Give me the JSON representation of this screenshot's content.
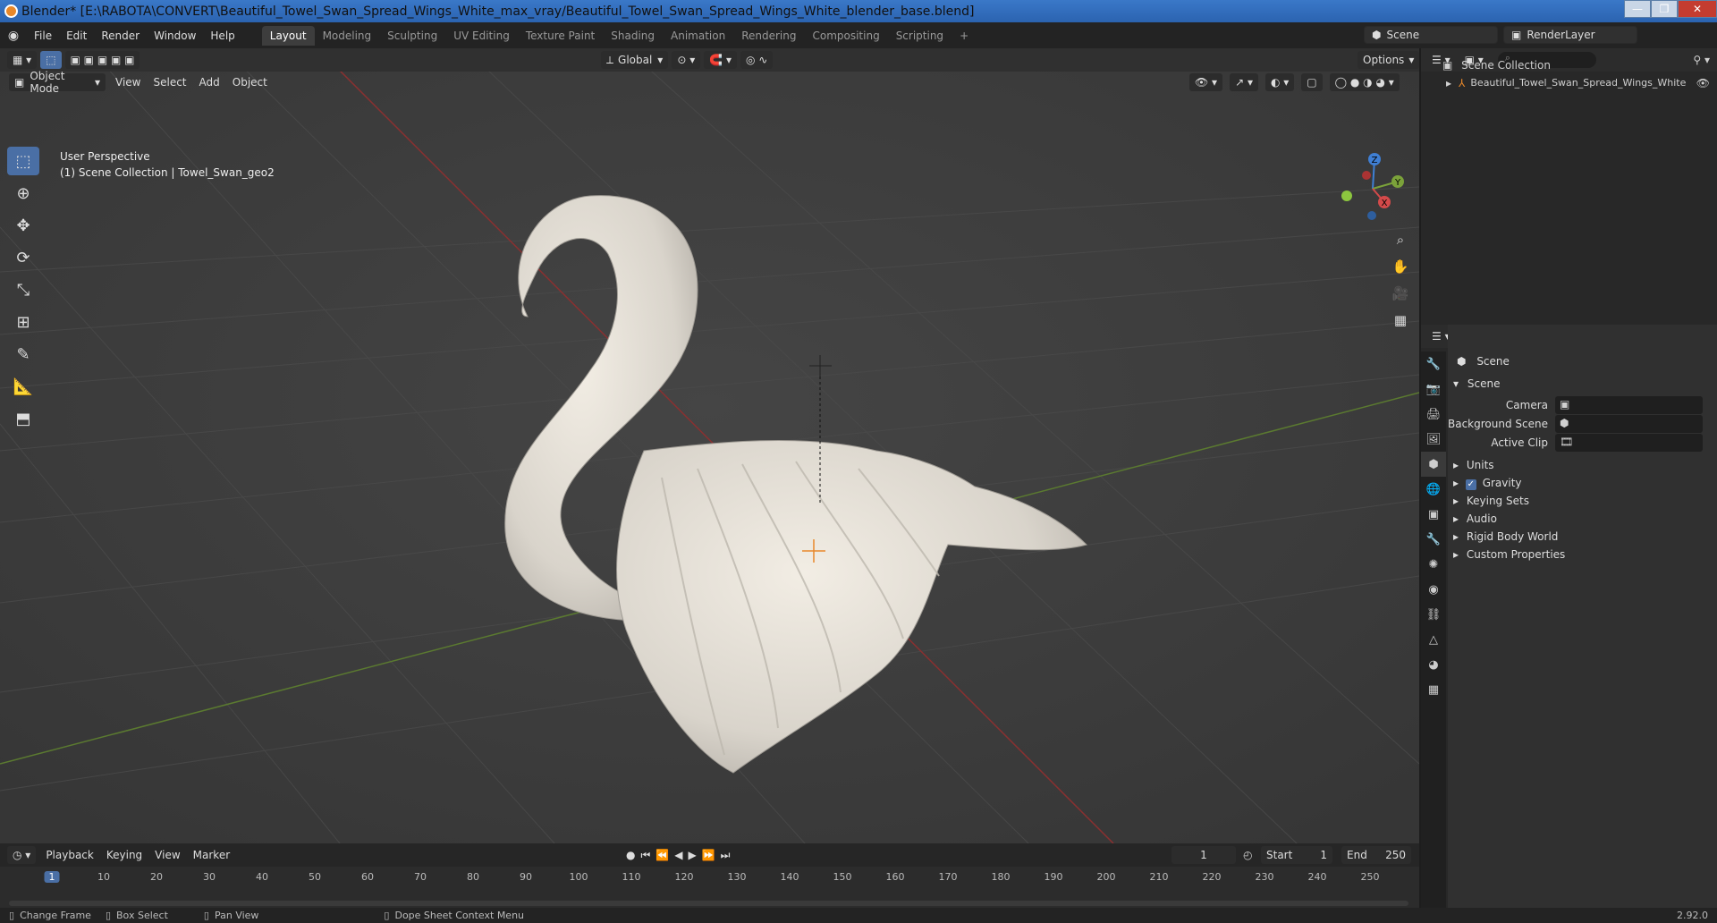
{
  "window": {
    "title": "Blender* [E:\\RABOTA\\CONVERT\\Beautiful_Towel_Swan_Spread_Wings_White_max_vray/Beautiful_Towel_Swan_Spread_Wings_White_blender_base.blend]"
  },
  "menu": [
    "File",
    "Edit",
    "Render",
    "Window",
    "Help"
  ],
  "workspaces": [
    "Layout",
    "Modeling",
    "Sculpting",
    "UV Editing",
    "Texture Paint",
    "Shading",
    "Animation",
    "Rendering",
    "Compositing",
    "Scripting"
  ],
  "workspace_add": "+",
  "scene_field": "Scene",
  "renderlayer_field": "RenderLayer",
  "viewport": {
    "transform_orientation": "Global",
    "options_label": "Options",
    "mode": "Object Mode",
    "header_menus": [
      "View",
      "Select",
      "Add",
      "Object"
    ],
    "perspective": "User Perspective",
    "collection_info": "(1) Scene Collection | Towel_Swan_geo2",
    "gizmo": {
      "x": "X",
      "y": "Y",
      "z": "Z"
    }
  },
  "outliner": {
    "root": "Scene Collection",
    "item": "Beautiful_Towel_Swan_Spread_Wings_White"
  },
  "properties": {
    "context": "Scene",
    "panel_title": "Scene",
    "camera_label": "Camera",
    "background_scene_label": "Background Scene",
    "active_clip_label": "Active Clip",
    "sections": [
      "Units",
      "Gravity",
      "Keying Sets",
      "Audio",
      "Rigid Body World",
      "Custom Properties"
    ]
  },
  "timeline": {
    "menus": [
      "Playback",
      "Keying",
      "View",
      "Marker"
    ],
    "current_frame": "1",
    "start_label": "Start",
    "start": "1",
    "end_label": "End",
    "end": "250",
    "ticks": [
      "1",
      "10",
      "20",
      "30",
      "40",
      "50",
      "60",
      "70",
      "80",
      "90",
      "100",
      "110",
      "120",
      "130",
      "140",
      "150",
      "160",
      "170",
      "180",
      "190",
      "200",
      "210",
      "220",
      "230",
      "240",
      "250"
    ]
  },
  "statusbar": {
    "items": [
      "Change Frame",
      "Box Select",
      "Pan View",
      "Dope Sheet Context Menu"
    ],
    "version": "2.92.0"
  },
  "colors": {
    "accent": "#4a6fa5",
    "x_axis": "#d44a4a",
    "y_axis": "#7ba23a",
    "z_axis": "#3f7fd4"
  }
}
